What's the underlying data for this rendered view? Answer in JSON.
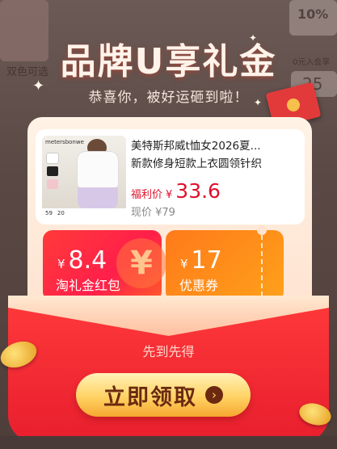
{
  "background": {
    "corner_labels": [
      "双色可选",
      "10%",
      "0元入会享",
      "25"
    ]
  },
  "popup": {
    "title": "品牌U享礼金",
    "subtitle": "恭喜你，被好运砸到啦！",
    "product": {
      "thumb_brand": "metersbonwe",
      "thumb_price_left": "59",
      "thumb_price_right": "20",
      "name_line1": "美特斯邦威t恤女2026夏...",
      "name_line2": "新款修身短款上衣圆领针织",
      "deal_label": "福利价",
      "currency": "¥",
      "deal_price": "33.6",
      "original_label": "现价 ¥79"
    },
    "coupons": [
      {
        "currency": "¥",
        "amount": "8.4",
        "label": "淘礼金红包",
        "mark": "¥"
      },
      {
        "currency": "¥",
        "amount": "17",
        "label": "优惠券"
      }
    ],
    "first_come": "先到先得",
    "claim_button": "立即领取",
    "claim_arrow": "›"
  },
  "colors": {
    "deal_red": "#e0102c",
    "envelope_red": "#e81e2e",
    "button_gold": "#ffd264"
  }
}
